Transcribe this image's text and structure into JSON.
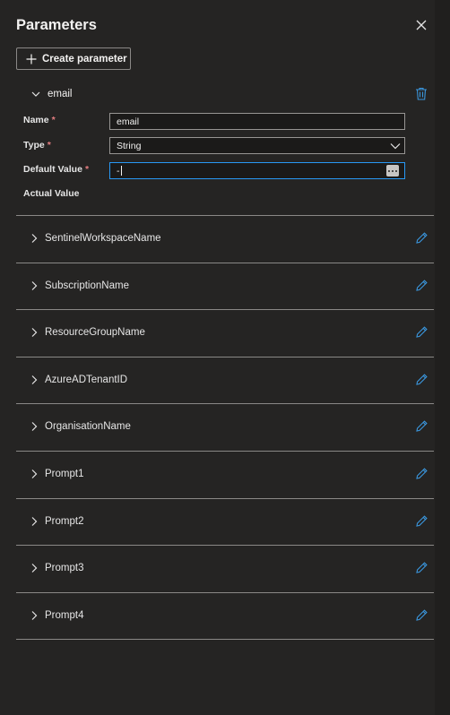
{
  "panel": {
    "title": "Parameters",
    "create_button_label": "Create parameter"
  },
  "expanded_param": {
    "name": "email",
    "fields": {
      "name_label": "Name",
      "name_value": "email",
      "type_label": "Type",
      "type_value": "String",
      "default_label": "Default Value",
      "default_value": "-",
      "actual_label": "Actual Value"
    },
    "required_marker": "*"
  },
  "parameters": [
    {
      "label": "SentinelWorkspaceName"
    },
    {
      "label": "SubscriptionName"
    },
    {
      "label": "ResourceGroupName"
    },
    {
      "label": "AzureADTenantID"
    },
    {
      "label": "OrganisationName"
    },
    {
      "label": "Prompt1"
    },
    {
      "label": "Prompt2"
    },
    {
      "label": "Prompt3"
    },
    {
      "label": "Prompt4"
    }
  ],
  "colors": {
    "background": "#252423",
    "accent": "#2899f5",
    "required": "#e37d80",
    "icon_blue": "#3a96dd"
  },
  "icons": [
    "close-icon",
    "plus-icon",
    "chevron-down-icon",
    "trash-icon",
    "chevron-right-icon",
    "pencil-icon",
    "ellipsis-icon"
  ]
}
